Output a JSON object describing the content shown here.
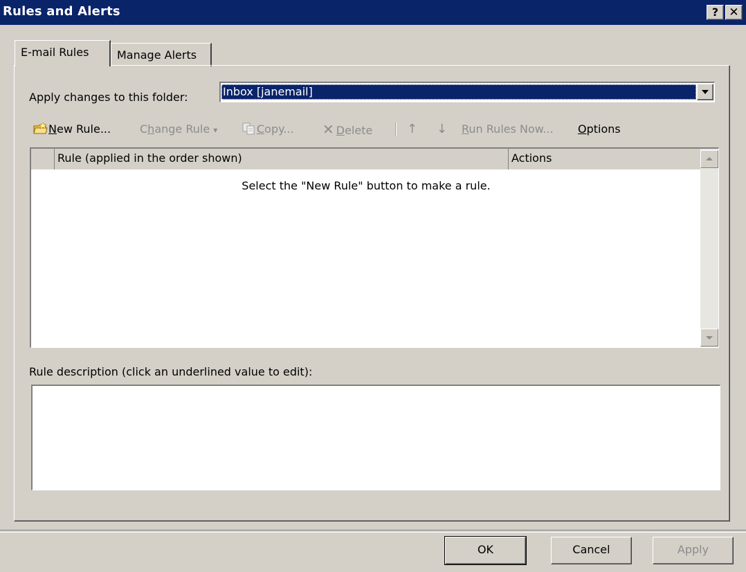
{
  "window": {
    "title": "Rules and Alerts",
    "help_button": "?",
    "close_button": "✕"
  },
  "tabs": [
    {
      "label": "E-mail Rules",
      "selected": true
    },
    {
      "label": "Manage Alerts"
    }
  ],
  "folder": {
    "label": "Apply changes to this folder:",
    "selected_value": "Inbox [janemail]"
  },
  "toolbar": {
    "new_rule_pre": "",
    "new_rule_u": "N",
    "new_rule_post": "ew Rule...",
    "change_rule_pre": "C",
    "change_rule_u": "h",
    "change_rule_post": "ange Rule",
    "change_rule_arrow": "▾",
    "copy_u": "C",
    "copy_post": "opy...",
    "delete_u": "D",
    "delete_post": "elete",
    "delete_icon": "✕",
    "move_up_icon": "↑",
    "move_down_icon": "↓",
    "run_rules_u": "R",
    "run_rules_post": "un Rules Now...",
    "options_u": "O",
    "options_post": "ptions"
  },
  "rules_list": {
    "columns": [
      "",
      "Rule (applied in the order shown)",
      "Actions"
    ],
    "empty_message": "Select the \"New Rule\" button to make a rule.",
    "rows": []
  },
  "description": {
    "label": "Rule description (click an underlined value to edit):",
    "text": ""
  },
  "buttons": {
    "ok": "OK",
    "cancel": "Cancel",
    "apply": "Apply"
  }
}
